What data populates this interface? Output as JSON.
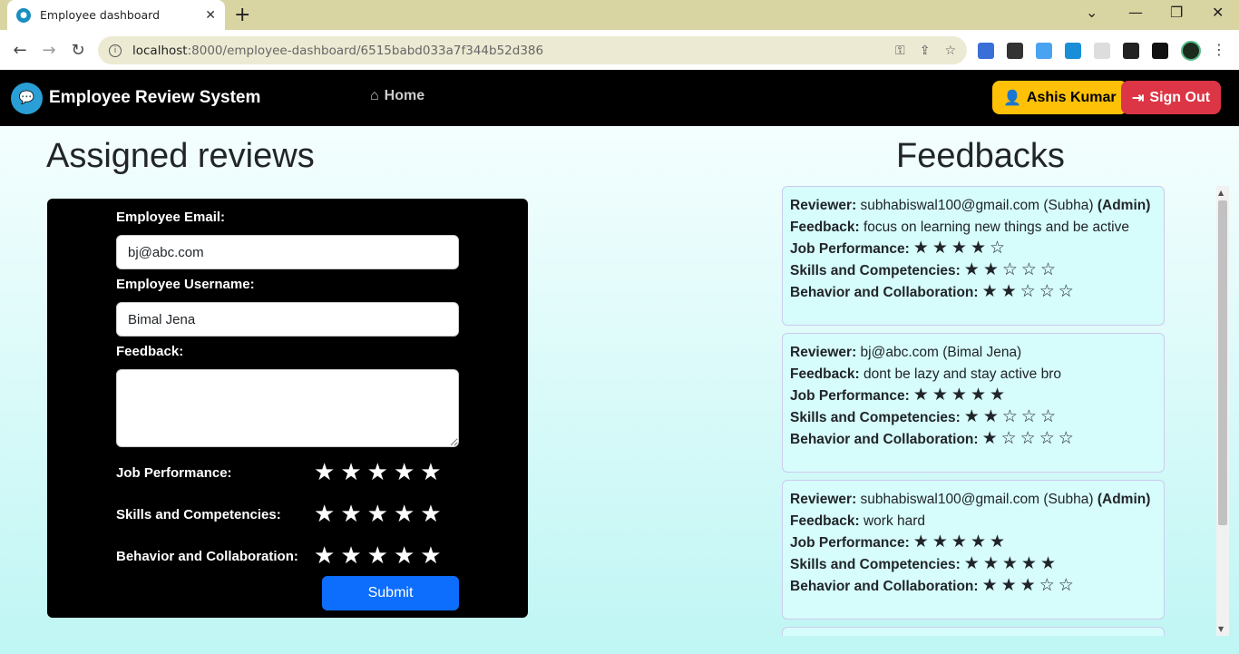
{
  "browser": {
    "tab_title": "Employee dashboard",
    "url_host": "localhost",
    "url_path": ":8000/employee-dashboard/6515babd033a7f344b52d386"
  },
  "navbar": {
    "brand": "Employee Review System",
    "home_label": "Home",
    "user_label": "Ashis Kumar",
    "signout_label": "Sign Out"
  },
  "assigned": {
    "heading": "Assigned reviews",
    "email_label": "Employee Email:",
    "email_value": "bj@abc.com",
    "username_label": "Employee Username:",
    "username_value": "Bimal Jena",
    "feedback_label": "Feedback:",
    "ratings": [
      {
        "label": "Job Performance:",
        "stars": 5
      },
      {
        "label": "Skills and Competencies:",
        "stars": 5
      },
      {
        "label": "Behavior and Collaboration:",
        "stars": 5
      }
    ],
    "submit_label": "Submit"
  },
  "feedbacks": {
    "heading": "Feedbacks",
    "reviewer_label": "Reviewer:",
    "feedback_label": "Feedback:",
    "job_label": "Job Performance:",
    "skills_label": "Skills and Competencies:",
    "behavior_label": "Behavior and Collaboration:",
    "items": [
      {
        "reviewer": "subhabiswal100@gmail.com (Subha)",
        "admin": "(Admin)",
        "feedback": "focus on learning new things and be active",
        "job": 4,
        "skills": 2,
        "behavior": 2
      },
      {
        "reviewer": "bj@abc.com (Bimal Jena)",
        "admin": "",
        "feedback": "dont be lazy and stay active bro",
        "job": 5,
        "skills": 2,
        "behavior": 1
      },
      {
        "reviewer": "subhabiswal100@gmail.com (Subha)",
        "admin": "(Admin)",
        "feedback": "work hard",
        "job": 5,
        "skills": 5,
        "behavior": 3
      }
    ]
  }
}
